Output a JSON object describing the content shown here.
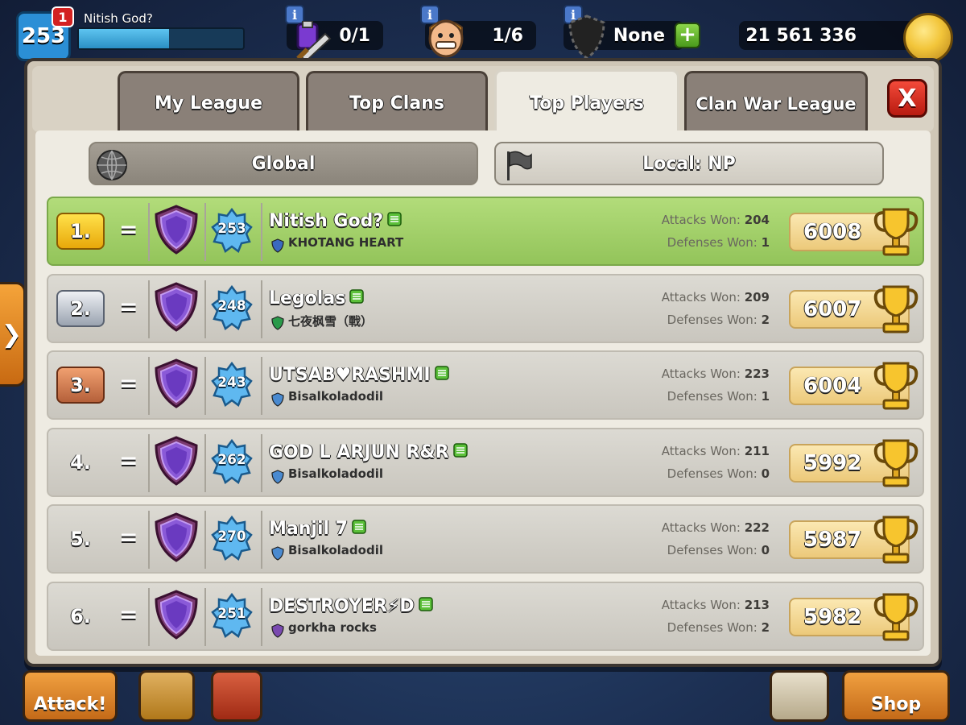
{
  "hud": {
    "level": "253",
    "notifications": "1",
    "player_name": "Nitish God?",
    "xp_progress": 0.55,
    "builders_potions": "0/1",
    "builders": "1/6",
    "shield": "None",
    "plus": "+",
    "gold": "21 561 336",
    "info": "i"
  },
  "tabs": [
    {
      "label": "My League",
      "active": false
    },
    {
      "label": "Top Clans",
      "active": false
    },
    {
      "label": "Top Players",
      "active": true
    },
    {
      "label": "Clan War League",
      "active": false
    }
  ],
  "close_label": "X",
  "scope": {
    "global": "Global",
    "local": "Local: NP",
    "selected": "global"
  },
  "stats_labels": {
    "attacks": "Attacks Won:",
    "defenses": "Defenses Won:"
  },
  "players": [
    {
      "rank": "1.",
      "change": "=",
      "level": "253",
      "name": "Nitish God?",
      "clan": "KHOTANG HEART",
      "attacks": "204",
      "defenses": "1",
      "trophies": "6008",
      "rank_style": "gold"
    },
    {
      "rank": "2.",
      "change": "=",
      "level": "248",
      "name": "Legolas",
      "clan": "七夜枫雪（戰）",
      "attacks": "209",
      "defenses": "2",
      "trophies": "6007",
      "rank_style": "silver"
    },
    {
      "rank": "3.",
      "change": "=",
      "level": "243",
      "name": "UTSAB♥RASHMI",
      "clan": "Bisalkoladodil",
      "attacks": "223",
      "defenses": "1",
      "trophies": "6004",
      "rank_style": "bronze"
    },
    {
      "rank": "4.",
      "change": "=",
      "level": "262",
      "name": "GOD L ARJUN R&R",
      "clan": "Bisalkoladodil",
      "attacks": "211",
      "defenses": "0",
      "trophies": "5992",
      "rank_style": "plain"
    },
    {
      "rank": "5.",
      "change": "=",
      "level": "270",
      "name": "Manjil 7",
      "clan": "Bisalkoladodil",
      "attacks": "222",
      "defenses": "0",
      "trophies": "5987",
      "rank_style": "plain"
    },
    {
      "rank": "6.",
      "change": "=",
      "level": "251",
      "name": "DESTROYER⚡D",
      "clan": "gorkha rocks",
      "attacks": "213",
      "defenses": "2",
      "trophies": "5982",
      "rank_style": "plain"
    }
  ],
  "bottom": {
    "attack": "Attack!",
    "shop": "Shop"
  },
  "colors": {
    "highlight_row": "#a5d06a",
    "gold_rank": "#f5c21e",
    "silver_rank": "#c4cad4",
    "bronze_rank": "#d9844f",
    "close_button": "#d8281a"
  }
}
